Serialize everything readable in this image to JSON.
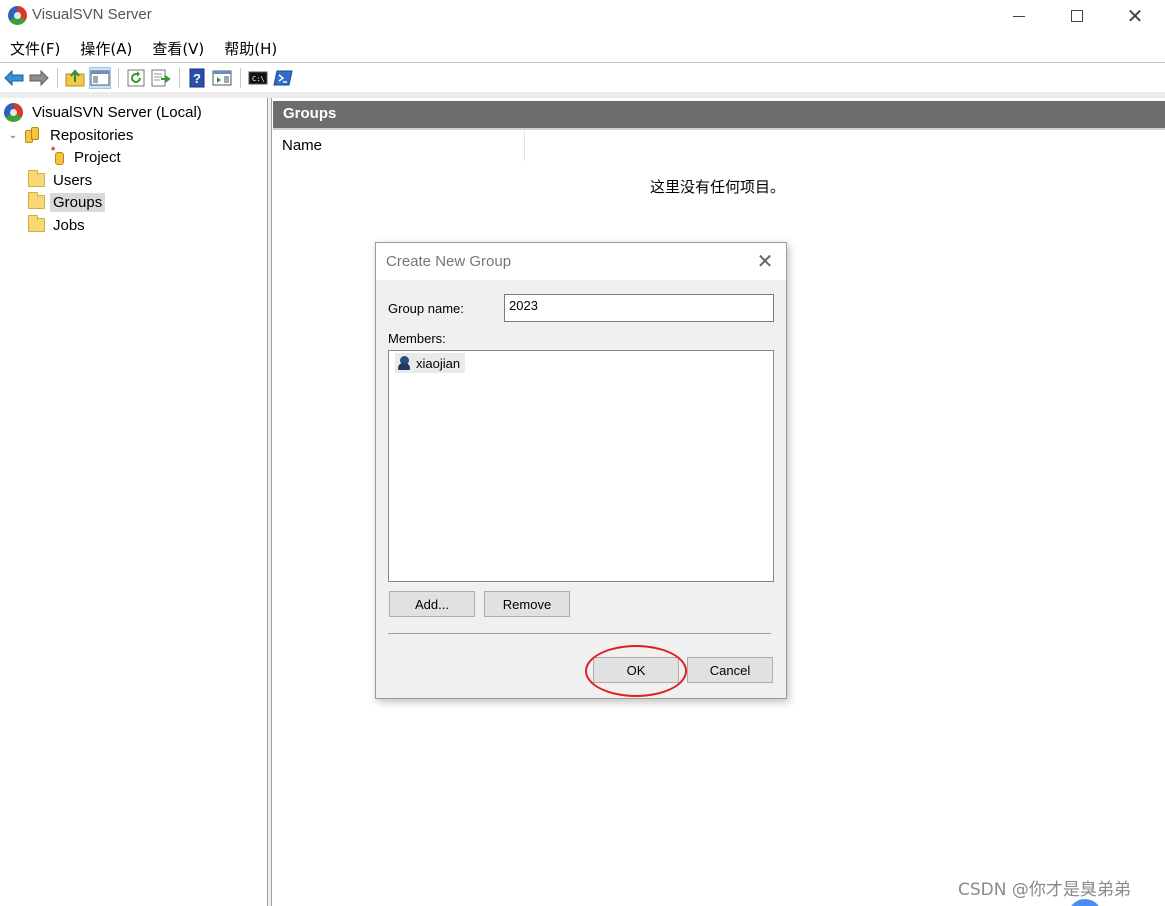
{
  "window": {
    "title": "VisualSVN Server",
    "min_glyph": "",
    "max_glyph": "",
    "close_glyph": "✕"
  },
  "menu": [
    {
      "label": "文件(F)"
    },
    {
      "label": "操作(A)"
    },
    {
      "label": "查看(V)"
    },
    {
      "label": "帮助(H)"
    }
  ],
  "toolbar": {
    "icons": [
      "back-arrow-icon",
      "forward-arrow-icon",
      "up-folder-icon",
      "show-hide-tree-icon",
      "refresh-icon",
      "export-list-icon",
      "help-icon",
      "action-pane-icon",
      "command-prompt-icon",
      "powershell-icon"
    ]
  },
  "tree": {
    "root": "VisualSVN Server (Local)",
    "repositories": "Repositories",
    "project": "Project",
    "users": "Users",
    "groups": "Groups",
    "jobs": "Jobs",
    "expand_glyph": "⌄"
  },
  "content": {
    "header": "Groups",
    "column_name": "Name",
    "empty_message": "这里没有任何项目。"
  },
  "dialog": {
    "title": "Create New Group",
    "close_glyph": "✕",
    "group_name_label": "Group name:",
    "group_name_value": "2023",
    "members_label": "Members:",
    "members": [
      "xiaojian"
    ],
    "add_label": "Add...",
    "remove_label": "Remove",
    "ok_label": "OK",
    "cancel_label": "Cancel",
    "highlight_color": "#e02020"
  },
  "watermark": "CSDN @你才是臭弟弟"
}
